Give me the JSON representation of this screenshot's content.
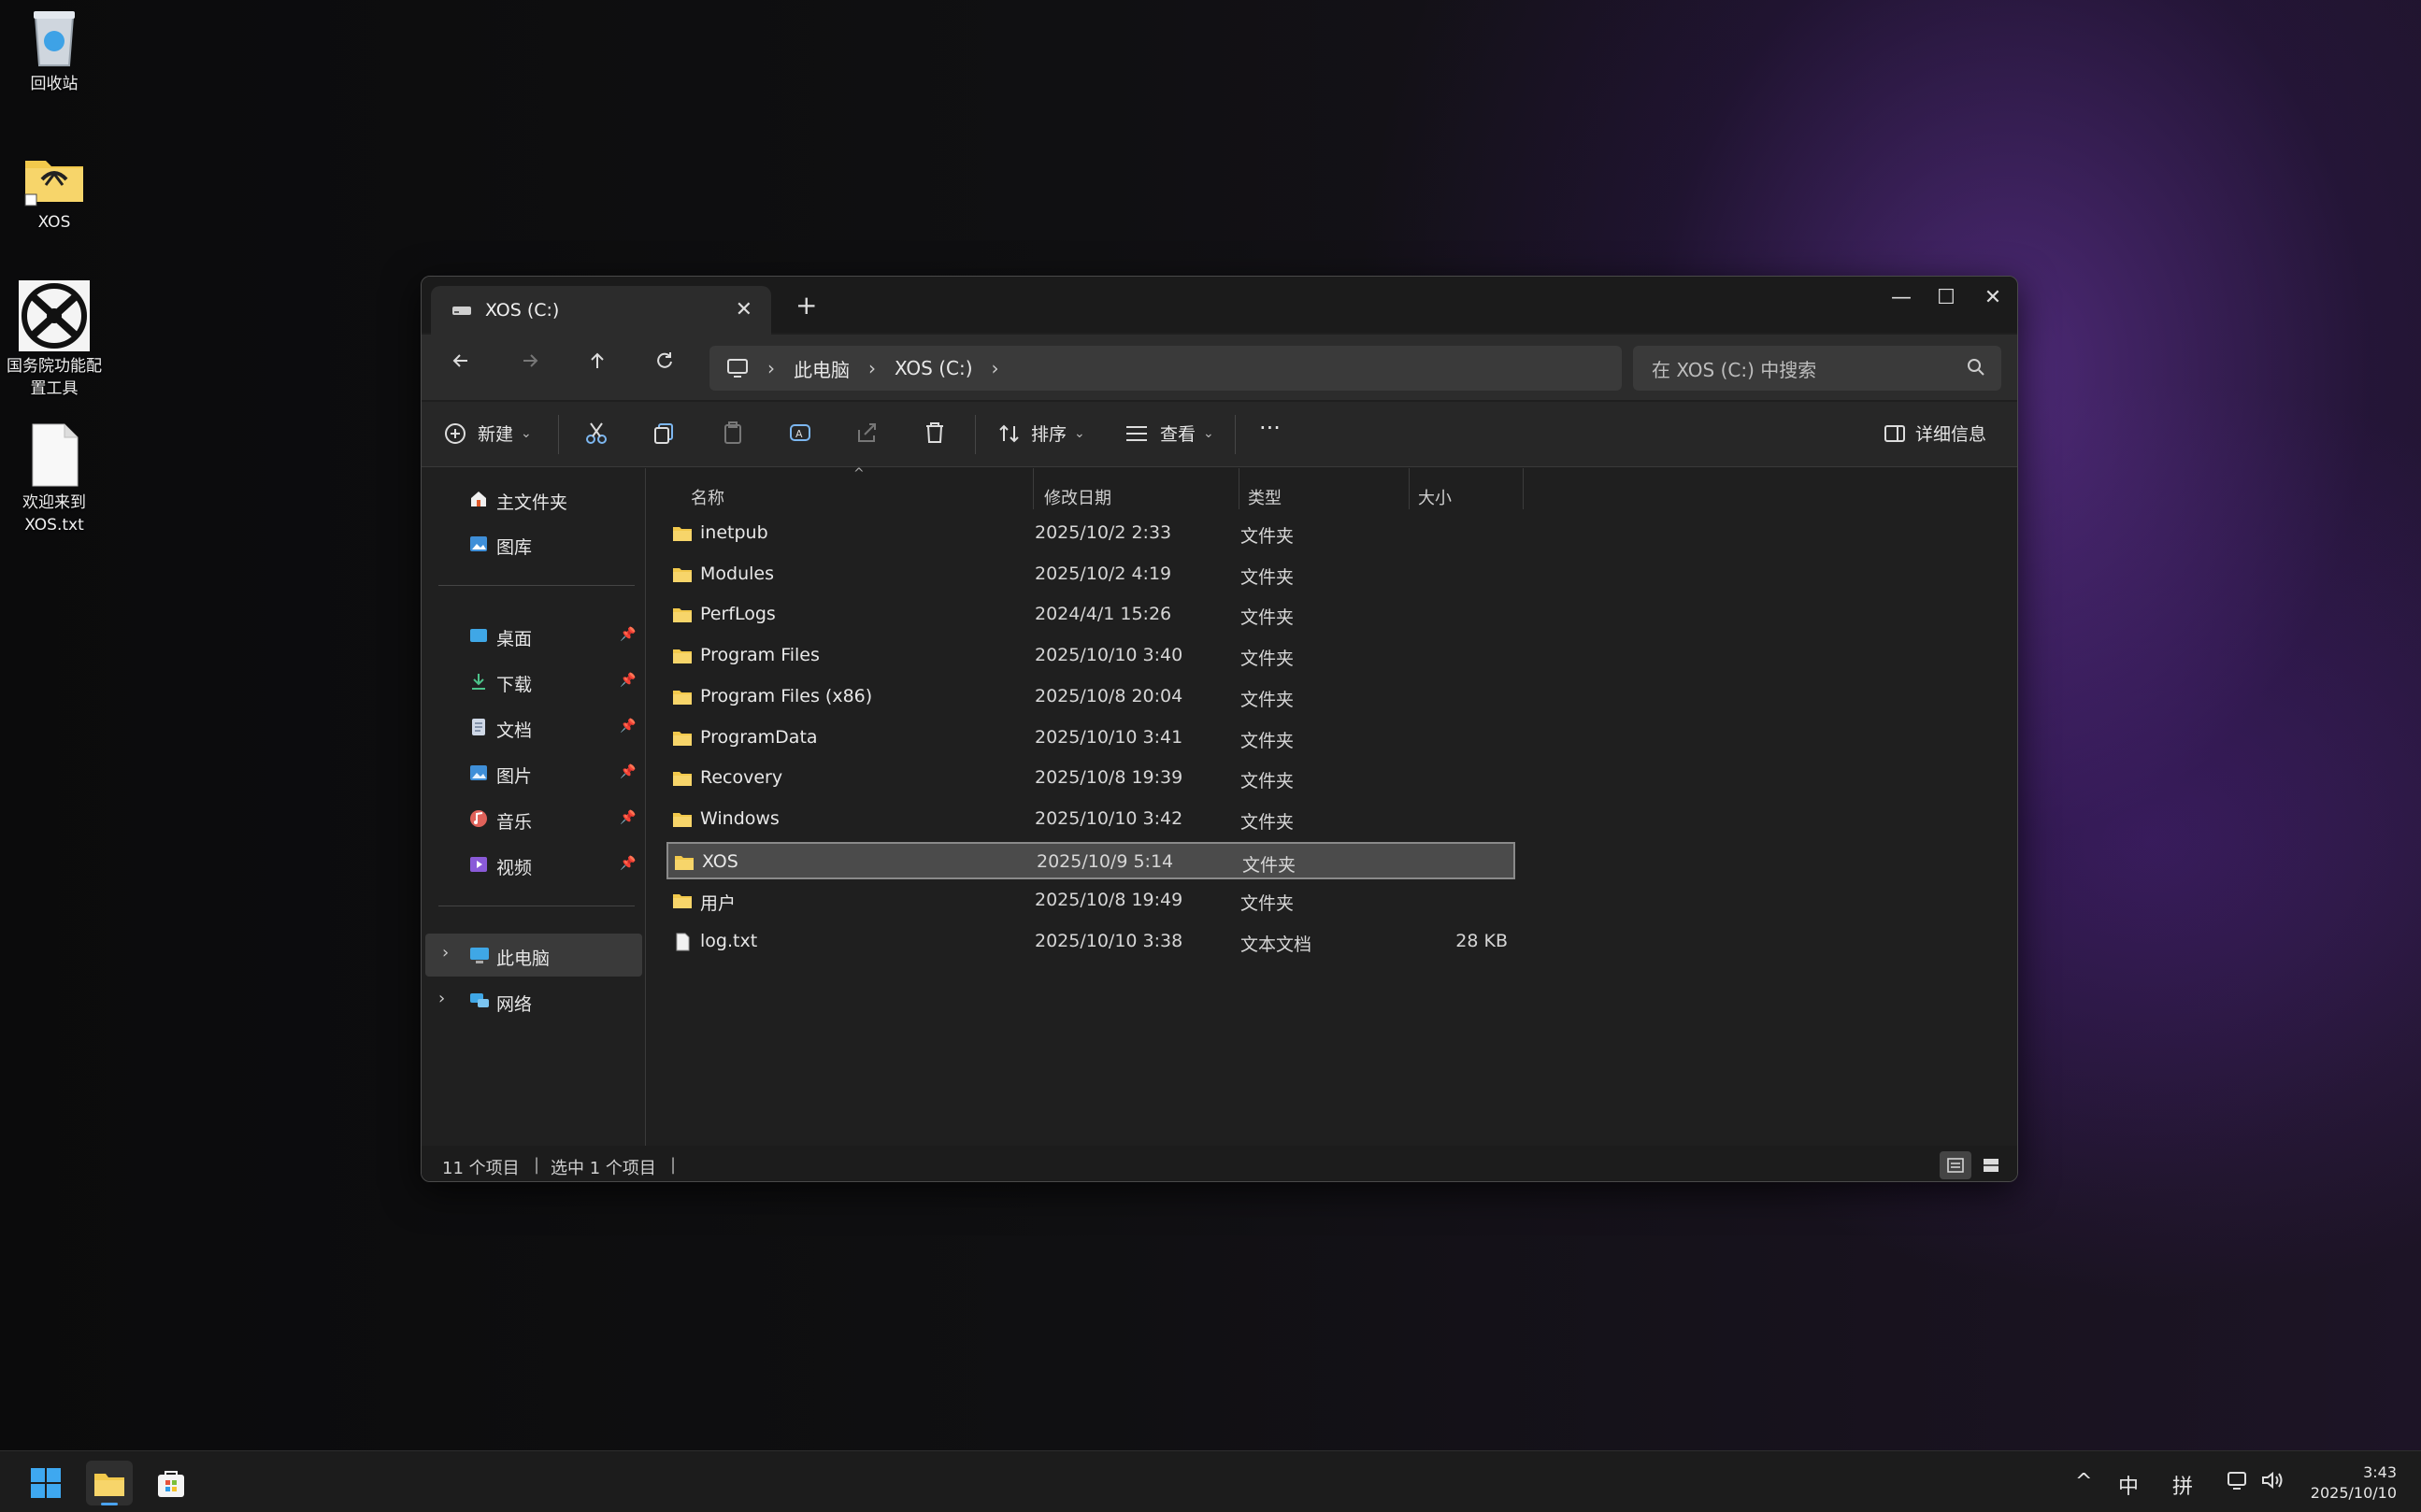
{
  "desktop": {
    "icons": [
      {
        "label": "回收站"
      },
      {
        "label": "XOS"
      },
      {
        "label": "国务院功能配置工具"
      },
      {
        "label": "欢迎来到 XOS.txt"
      }
    ]
  },
  "window": {
    "tab_title": "XOS (C:)",
    "tab_close": "✕",
    "new_tab": "+",
    "controls": {
      "minimize": "—",
      "maximize": "☐",
      "close": "✕"
    },
    "breadcrumb": [
      "此电脑",
      "XOS (C:)"
    ],
    "search_placeholder": "在 XOS (C:) 中搜索",
    "toolbar": {
      "new_label": "新建",
      "sort_label": "排序",
      "view_label": "查看",
      "more_label": "···",
      "details_label": "详细信息"
    },
    "sidebar": {
      "top": [
        {
          "label": "主文件夹",
          "icon": "home-icon"
        },
        {
          "label": "图库",
          "icon": "gallery-icon"
        }
      ],
      "pinned": [
        {
          "label": "桌面",
          "icon": "desktop-icon"
        },
        {
          "label": "下载",
          "icon": "download-icon"
        },
        {
          "label": "文档",
          "icon": "document-icon"
        },
        {
          "label": "图片",
          "icon": "pictures-icon"
        },
        {
          "label": "音乐",
          "icon": "music-icon"
        },
        {
          "label": "视频",
          "icon": "video-icon"
        }
      ],
      "bottom": [
        {
          "label": "此电脑",
          "icon": "pc-icon"
        },
        {
          "label": "网络",
          "icon": "network-icon"
        }
      ]
    },
    "columns": {
      "name": "名称",
      "modified": "修改日期",
      "type": "类型",
      "size": "大小"
    },
    "files": [
      {
        "name": "inetpub",
        "date": "2025/10/2 2:33",
        "type": "文件夹",
        "size": ""
      },
      {
        "name": "Modules",
        "date": "2025/10/2 4:19",
        "type": "文件夹",
        "size": ""
      },
      {
        "name": "PerfLogs",
        "date": "2024/4/1 15:26",
        "type": "文件夹",
        "size": ""
      },
      {
        "name": "Program Files",
        "date": "2025/10/10 3:40",
        "type": "文件夹",
        "size": ""
      },
      {
        "name": "Program Files (x86)",
        "date": "2025/10/8 20:04",
        "type": "文件夹",
        "size": ""
      },
      {
        "name": "ProgramData",
        "date": "2025/10/10 3:41",
        "type": "文件夹",
        "size": ""
      },
      {
        "name": "Recovery",
        "date": "2025/10/8 19:39",
        "type": "文件夹",
        "size": ""
      },
      {
        "name": "Windows",
        "date": "2025/10/10 3:42",
        "type": "文件夹",
        "size": ""
      },
      {
        "name": "XOS",
        "date": "2025/10/9 5:14",
        "type": "文件夹",
        "size": ""
      },
      {
        "name": "用户",
        "date": "2025/10/8 19:49",
        "type": "文件夹",
        "size": ""
      },
      {
        "name": "log.txt",
        "date": "2025/10/10 3:38",
        "type": "文本文档",
        "size": "28 KB"
      }
    ],
    "status": {
      "count": "11 个项目",
      "selected": "选中 1 个项目"
    }
  },
  "taskbar": {
    "tray": {
      "chevron": "^",
      "ime_lang": "中",
      "ime_mode": "拼"
    },
    "clock": {
      "time": "3:43",
      "date": "2025/10/10"
    }
  },
  "colors": {
    "folder": "#f2c94c",
    "accent": "#4aa3f0",
    "selection": "#4b4b4b"
  }
}
